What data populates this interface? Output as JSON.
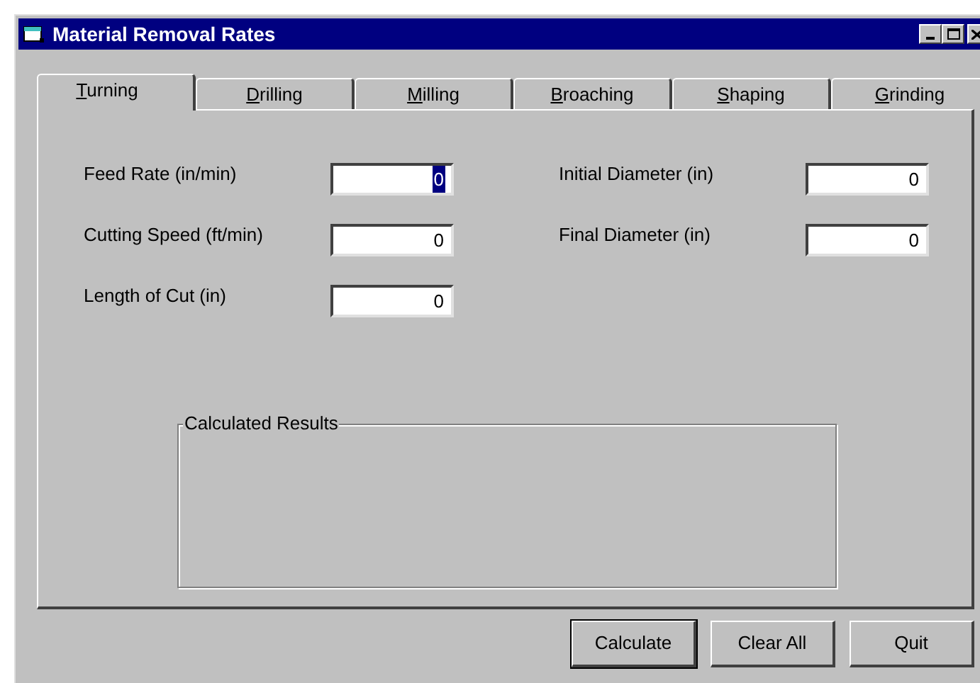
{
  "window": {
    "title": "Material Removal Rates"
  },
  "tabs": [
    {
      "key": "T",
      "rest": "urning",
      "selected": true
    },
    {
      "key": "D",
      "rest": "rilling",
      "selected": false
    },
    {
      "key": "M",
      "rest": "illing",
      "selected": false
    },
    {
      "key": "B",
      "rest": "roaching",
      "selected": false
    },
    {
      "key": "S",
      "rest": "haping",
      "selected": false
    },
    {
      "key": "G",
      "rest": "rinding",
      "selected": false
    }
  ],
  "left_fields": [
    {
      "label": "Feed Rate (in/min)",
      "value": "0",
      "selected": true
    },
    {
      "label": "Cutting Speed (ft/min)",
      "value": "0",
      "selected": false
    },
    {
      "label": "Length of Cut (in)",
      "value": "0",
      "selected": false
    }
  ],
  "right_fields": [
    {
      "label": "Initial Diameter (in)",
      "value": "0",
      "selected": false
    },
    {
      "label": "Final Diameter (in)",
      "value": "0",
      "selected": false
    }
  ],
  "results": {
    "title": "Calculated Results"
  },
  "buttons": [
    {
      "label": "Calculate",
      "default": true
    },
    {
      "label": "Clear All",
      "default": false
    },
    {
      "label": "Quit",
      "default": false
    }
  ]
}
